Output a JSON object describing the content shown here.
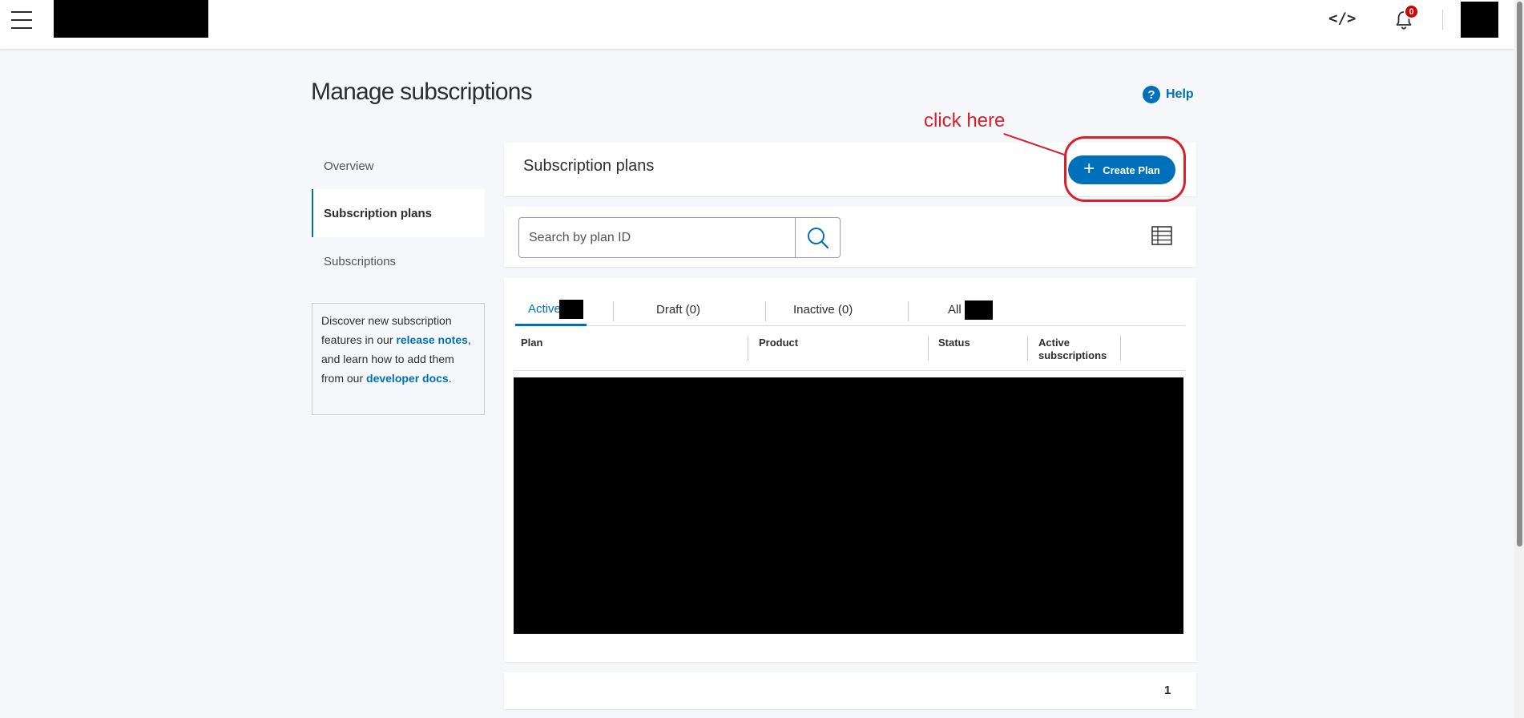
{
  "header": {
    "menu_icon": "hamburger-icon",
    "code_icon_label": "</>",
    "notifications_count": "0"
  },
  "page": {
    "title": "Manage subscriptions",
    "help_label": "Help",
    "help_icon_glyph": "?"
  },
  "sidebar": {
    "items": [
      {
        "label": "Overview",
        "active": false
      },
      {
        "label": "Subscription plans",
        "active": true
      },
      {
        "label": "Subscriptions",
        "active": false
      }
    ],
    "info": {
      "text1": "Discover new subscription features in our ",
      "link1": "release notes",
      "text2": ", and learn how to add them from our ",
      "link2": "developer docs",
      "text3": "."
    }
  },
  "annotation": {
    "text": "click here",
    "color": "#d6202b"
  },
  "plans": {
    "title": "Subscription plans",
    "create_label": "Create Plan",
    "create_icon": "+"
  },
  "search": {
    "placeholder": "Search by plan ID"
  },
  "tabs": [
    {
      "label": "Active",
      "active": true
    },
    {
      "label": "Draft (0)",
      "active": false
    },
    {
      "label": "Inactive (0)",
      "active": false
    },
    {
      "label": "All",
      "active": false
    }
  ],
  "table": {
    "columns": [
      "Plan",
      "Product",
      "Status",
      "Active subscriptions"
    ]
  },
  "pagination": {
    "current_page": "1"
  },
  "colors": {
    "accent": "#0070ba",
    "badge": "#d20000"
  }
}
